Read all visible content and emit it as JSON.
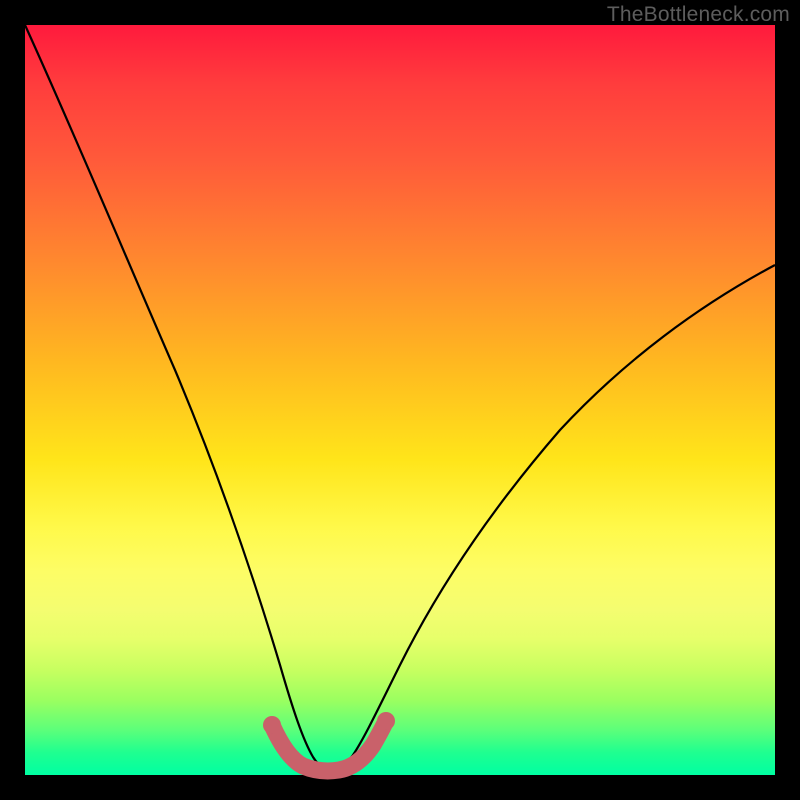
{
  "watermark": "TheBottleneck.com",
  "chart_data": {
    "type": "line",
    "title": "",
    "xlabel": "",
    "ylabel": "",
    "xlim": [
      0,
      100
    ],
    "ylim": [
      0,
      100
    ],
    "series": [
      {
        "name": "bottleneck-curve",
        "x": [
          0,
          4,
          8,
          12,
          16,
          20,
          24,
          28,
          31,
          33,
          35,
          37,
          39,
          41,
          43,
          46,
          50,
          56,
          62,
          70,
          78,
          88,
          100
        ],
        "y": [
          100,
          89,
          78,
          67,
          56,
          45,
          34,
          22,
          13,
          8,
          4,
          1.5,
          0.5,
          0.5,
          1.5,
          4,
          9,
          17,
          26,
          35,
          44,
          52,
          60
        ]
      },
      {
        "name": "optimal-band",
        "x": [
          31.5,
          33,
          35,
          37,
          39,
          41,
          43,
          44.5
        ],
        "y": [
          6.5,
          3.5,
          1.5,
          0.8,
          0.8,
          1.5,
          3.5,
          6.5
        ]
      }
    ],
    "colors": {
      "curve": "#000000",
      "band": "#c9616a",
      "gradient_top": "#ff1a3d",
      "gradient_bottom": "#00ffa2"
    }
  }
}
